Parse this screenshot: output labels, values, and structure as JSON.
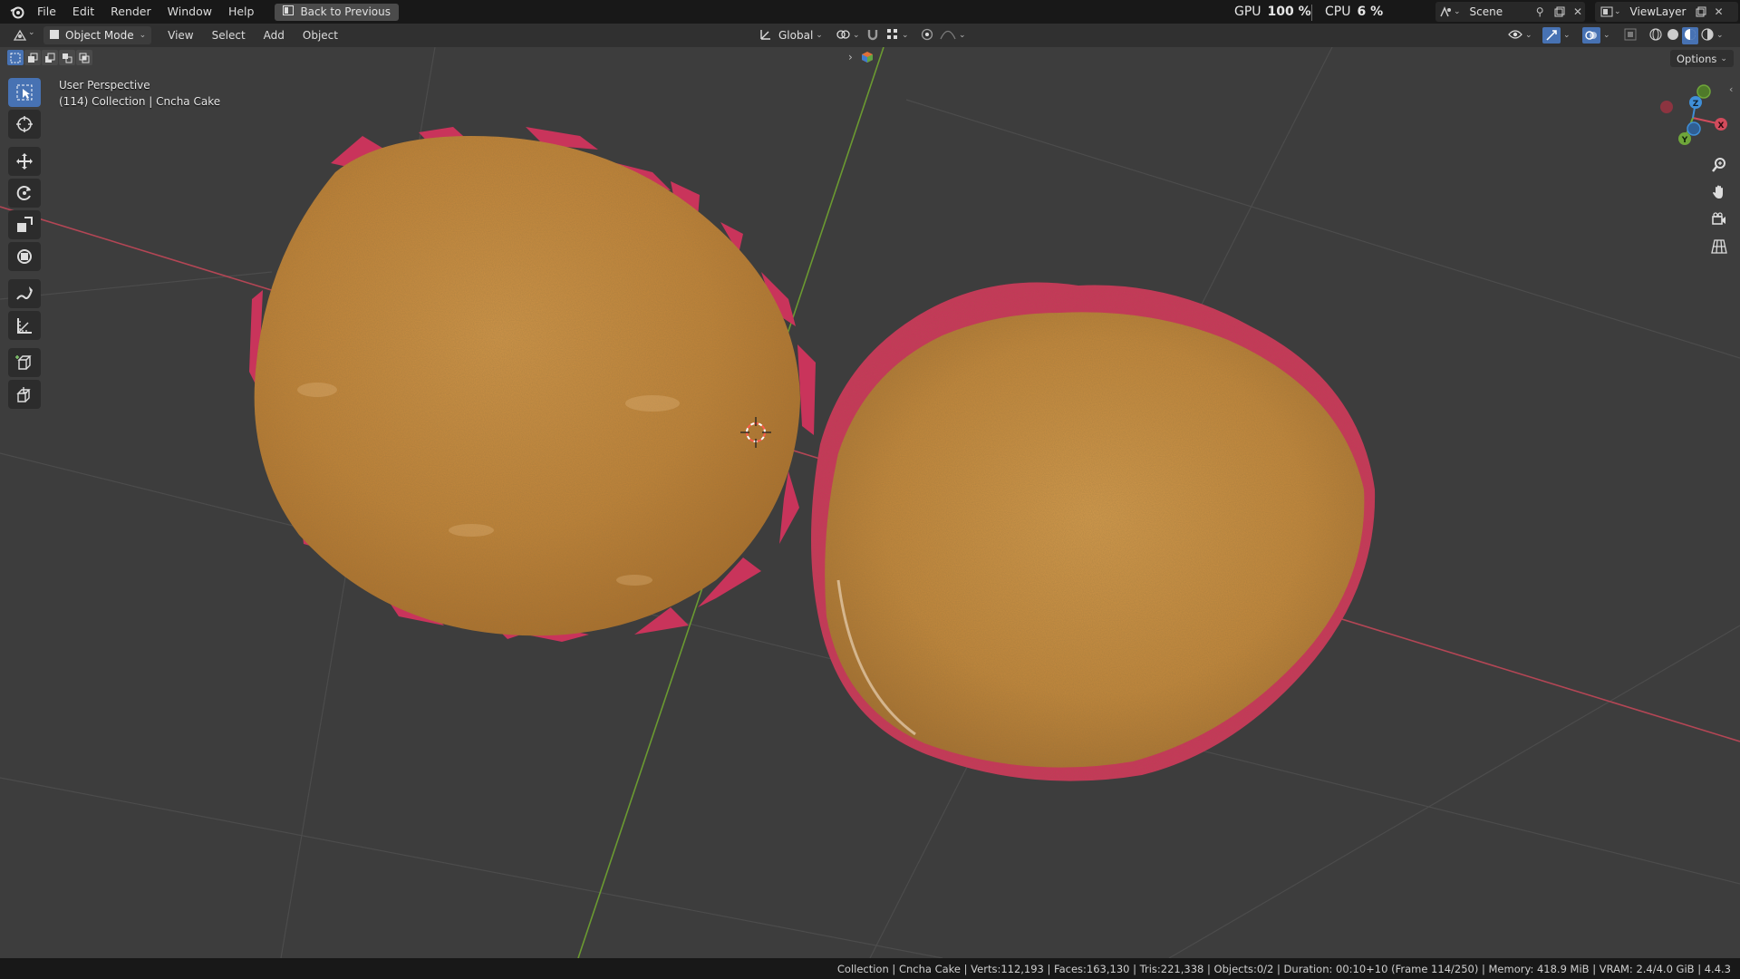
{
  "menu": {
    "items": [
      "File",
      "Edit",
      "Render",
      "Window",
      "Help"
    ],
    "back_button": "Back to Previous"
  },
  "performance": {
    "gpu_label": "GPU",
    "gpu_value": "100 %",
    "cpu_label": "CPU",
    "cpu_value": "6 %"
  },
  "scene": {
    "scene_name": "Scene",
    "view_layer": "ViewLayer"
  },
  "header": {
    "mode": "Object Mode",
    "menus": [
      "View",
      "Select",
      "Add",
      "Object"
    ],
    "transform_orientation": "Global",
    "options_label": "Options"
  },
  "viewport": {
    "perspective_label": "User Perspective",
    "collection_label": "(114) Collection | Cncha Cake",
    "axes": [
      "X",
      "Y",
      "Z"
    ]
  },
  "tools": [
    "select-box-tool",
    "cursor-tool",
    "move-tool",
    "rotate-tool",
    "scale-tool",
    "transform-tool",
    "annotate-tool",
    "measure-tool",
    "add-cube-tool",
    "extrude-tool"
  ],
  "status": {
    "text": "Collection | Cncha Cake | Verts:112,193 | Faces:163,130 | Tris:221,338 | Objects:0/2 | Duration: 00:10+10 (Frame 114/250) | Memory: 418.9 MiB | VRAM: 2.4/4.0 GiB | 4.4.3"
  },
  "colors": {
    "accent": "#4772b3",
    "x_axis": "#d24b5c",
    "y_axis": "#6fa63a",
    "z_axis": "#3f8fd8",
    "cake": "#c58a3c",
    "filling": "#c9345b"
  }
}
